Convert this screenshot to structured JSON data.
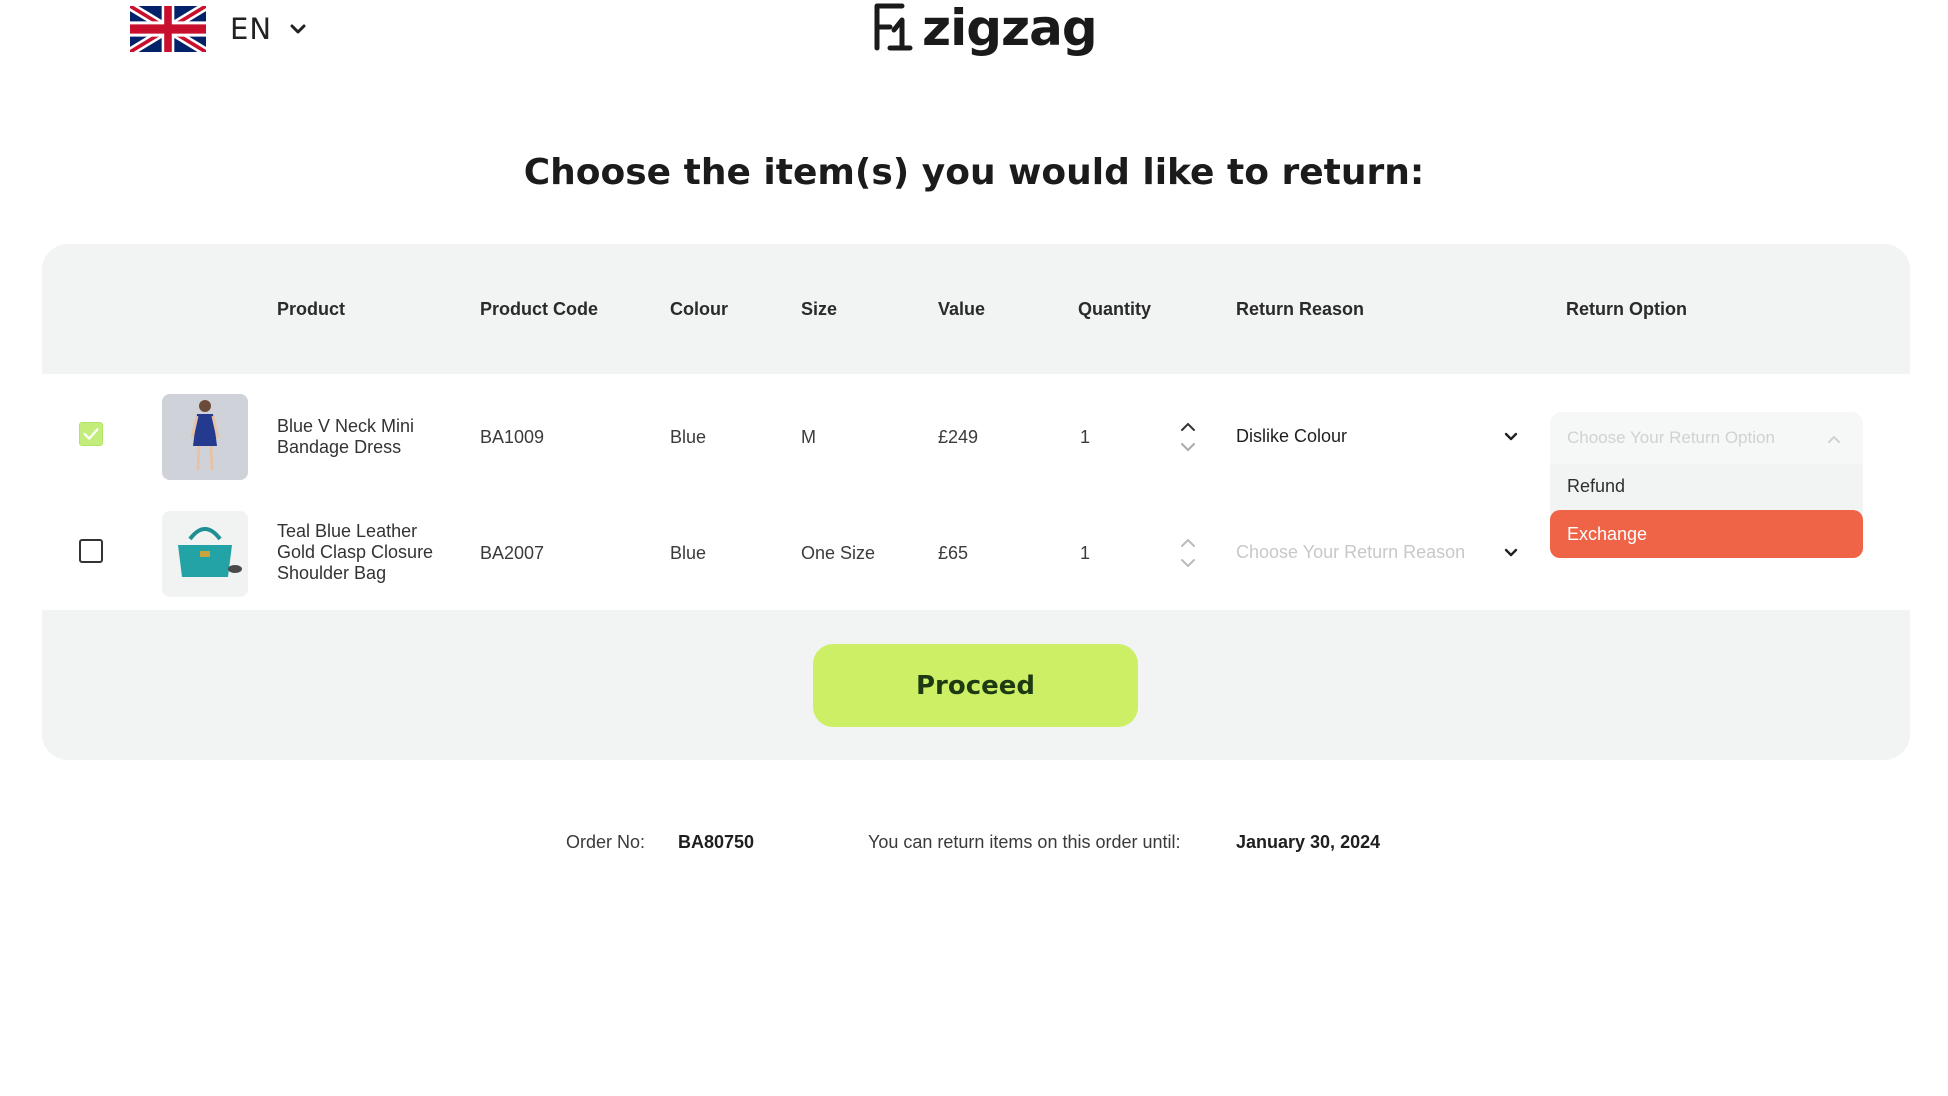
{
  "header": {
    "language_code": "EN",
    "flag_icon": "uk-flag-icon",
    "brand_name": "zigzag",
    "brand_color": "#1a1a1a"
  },
  "page": {
    "title": "Choose the item(s) you would like to return:"
  },
  "table": {
    "headers": {
      "product": "Product",
      "product_code": "Product Code",
      "colour": "Colour",
      "size": "Size",
      "value": "Value",
      "quantity": "Quantity",
      "return_reason": "Return Reason",
      "return_option": "Return Option"
    },
    "rows": [
      {
        "selected": true,
        "product_name": "Blue V Neck Mini Bandage Dress",
        "product_code": "BA1009",
        "colour": "Blue",
        "size": "M",
        "value": "£249",
        "quantity": "1",
        "return_reason": "Dislike Colour"
      },
      {
        "selected": false,
        "product_name": "Teal Blue Leather Gold Clasp Closure Shoulder Bag",
        "product_code": "BA2007",
        "colour": "Blue",
        "size": "One Size",
        "value": "£65",
        "quantity": "1",
        "return_reason_placeholder": "Choose Your Return Reason"
      }
    ],
    "return_option_dropdown": {
      "placeholder": "Choose Your Return Option",
      "options": [
        "Refund",
        "Exchange"
      ],
      "highlighted": "Exchange",
      "highlight_color": "#ef6347"
    }
  },
  "actions": {
    "proceed_label": "Proceed",
    "proceed_color": "#ccef66"
  },
  "footer": {
    "order_label": "Order No:",
    "order_number": "BA80750",
    "deadline_label": "You can return items on this order until:",
    "deadline_date": "January 30, 2024"
  }
}
